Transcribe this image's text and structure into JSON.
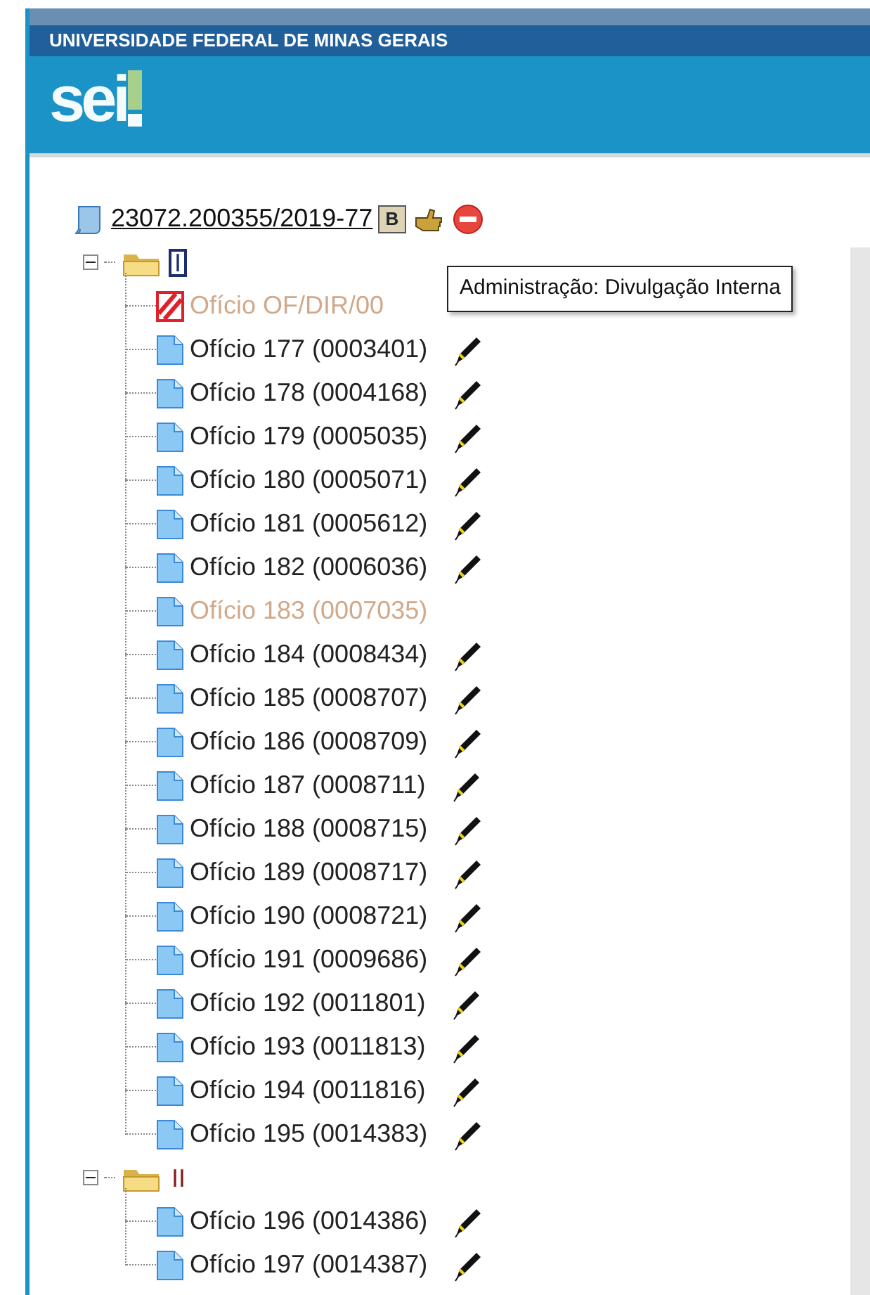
{
  "header": {
    "institution": "UNIVERSIDADE FEDERAL DE MINAS GERAIS",
    "logo": "sei"
  },
  "process": {
    "number": "23072.200355/2019-77 ",
    "badge": "B"
  },
  "folders": [
    {
      "label": "I",
      "expanded": true,
      "selected": true,
      "documents": [
        {
          "label": "Ofício OF/DIR/00",
          "kind": "cancelled",
          "faded": true,
          "signed": false
        },
        {
          "label": "Ofício 177 (0003401)",
          "kind": "document",
          "faded": false,
          "signed": true
        },
        {
          "label": "Ofício 178 (0004168)",
          "kind": "document",
          "faded": false,
          "signed": true
        },
        {
          "label": "Ofício 179 (0005035)",
          "kind": "document",
          "faded": false,
          "signed": true
        },
        {
          "label": "Ofício 180 (0005071)",
          "kind": "document",
          "faded": false,
          "signed": true
        },
        {
          "label": "Ofício 181 (0005612)",
          "kind": "document",
          "faded": false,
          "signed": true
        },
        {
          "label": "Ofício 182 (0006036)",
          "kind": "document",
          "faded": false,
          "signed": true
        },
        {
          "label": "Ofício 183 (0007035)",
          "kind": "document",
          "faded": true,
          "signed": false
        },
        {
          "label": "Ofício 184 (0008434)",
          "kind": "document",
          "faded": false,
          "signed": true
        },
        {
          "label": "Ofício 185 (0008707)",
          "kind": "document",
          "faded": false,
          "signed": true
        },
        {
          "label": "Ofício 186 (0008709)",
          "kind": "document",
          "faded": false,
          "signed": true
        },
        {
          "label": "Ofício 187 (0008711)",
          "kind": "document",
          "faded": false,
          "signed": true
        },
        {
          "label": "Ofício 188 (0008715)",
          "kind": "document",
          "faded": false,
          "signed": true
        },
        {
          "label": "Ofício 189 (0008717)",
          "kind": "document",
          "faded": false,
          "signed": true
        },
        {
          "label": "Ofício 190 (0008721)",
          "kind": "document",
          "faded": false,
          "signed": true
        },
        {
          "label": "Ofício 191 (0009686)",
          "kind": "document",
          "faded": false,
          "signed": true
        },
        {
          "label": "Ofício 192 (0011801)",
          "kind": "document",
          "faded": false,
          "signed": true
        },
        {
          "label": "Ofício 193 (0011813)",
          "kind": "document",
          "faded": false,
          "signed": true
        },
        {
          "label": "Ofício 194 (0011816)",
          "kind": "document",
          "faded": false,
          "signed": true
        },
        {
          "label": "Ofício 195 (0014383)",
          "kind": "document",
          "faded": false,
          "signed": true
        }
      ]
    },
    {
      "label": "II",
      "expanded": true,
      "selected": false,
      "documents": [
        {
          "label": "Ofício 196 (0014386)",
          "kind": "document",
          "faded": false,
          "signed": true
        },
        {
          "label": "Ofício 197 (0014387)",
          "kind": "document",
          "faded": false,
          "signed": true
        }
      ]
    }
  ],
  "tooltip": {
    "text": "Administração: Divulgação Interna"
  }
}
